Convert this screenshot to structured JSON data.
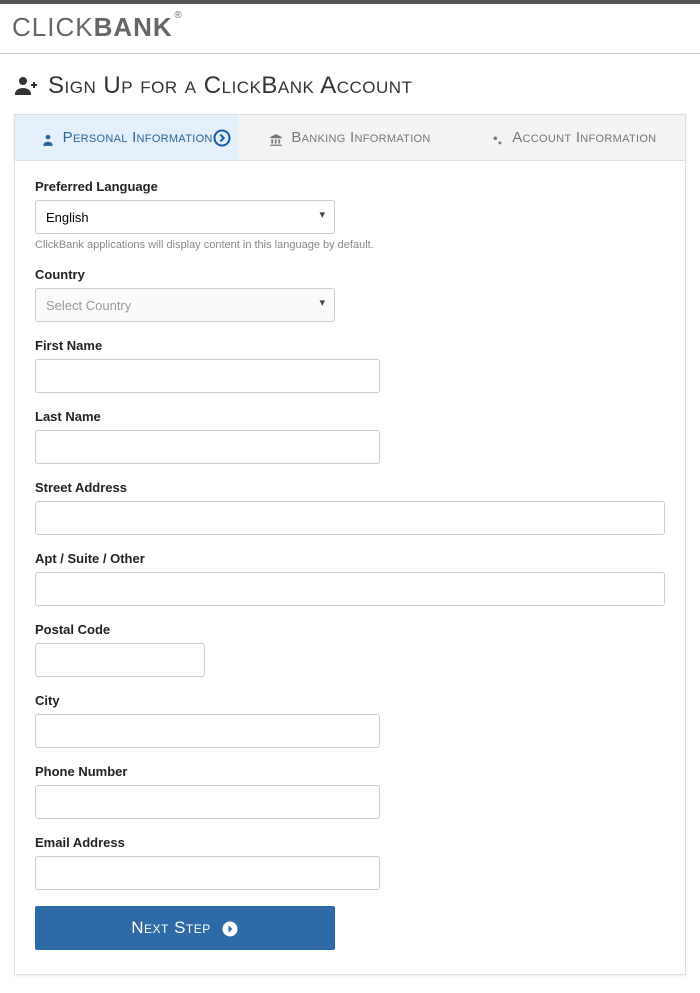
{
  "brand": {
    "click": "CLICK",
    "bank": "BANK",
    "reg": "®"
  },
  "page": {
    "title": "Sign Up for a ClickBank Account"
  },
  "tabs": {
    "personal": "Personal Information",
    "banking": "Banking Information",
    "account": "Account Information"
  },
  "form": {
    "preferred_language": {
      "label": "Preferred Language",
      "value": "English",
      "help": "ClickBank applications will display content in this language by default."
    },
    "country": {
      "label": "Country",
      "placeholder": "Select Country"
    },
    "first_name": {
      "label": "First Name"
    },
    "last_name": {
      "label": "Last Name"
    },
    "street": {
      "label": "Street Address"
    },
    "apt": {
      "label": "Apt / Suite / Other"
    },
    "postal": {
      "label": "Postal Code"
    },
    "city": {
      "label": "City"
    },
    "phone": {
      "label": "Phone Number"
    },
    "email": {
      "label": "Email Address"
    }
  },
  "buttons": {
    "next": "Next Step"
  }
}
